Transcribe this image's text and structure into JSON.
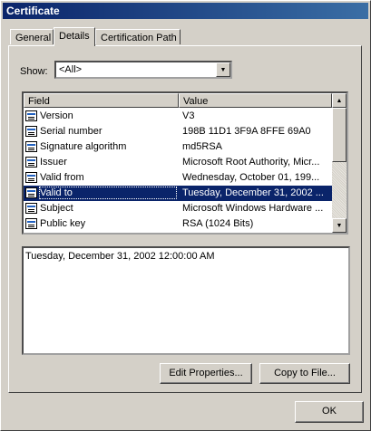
{
  "window": {
    "title": "Certificate"
  },
  "tabs": [
    "General",
    "Details",
    "Certification Path"
  ],
  "show": {
    "label": "Show:",
    "value": "<All>"
  },
  "list": {
    "columns": [
      "Field",
      "Value"
    ],
    "rows": [
      {
        "field": "Version",
        "value": "V3"
      },
      {
        "field": "Serial number",
        "value": "198B 11D1 3F9A 8FFE 69A0"
      },
      {
        "field": "Signature algorithm",
        "value": "md5RSA"
      },
      {
        "field": "Issuer",
        "value": "Microsoft Root Authority, Micr..."
      },
      {
        "field": "Valid from",
        "value": "Wednesday, October 01, 199..."
      },
      {
        "field": "Valid to",
        "value": "Tuesday, December 31, 2002 ..."
      },
      {
        "field": "Subject",
        "value": "Microsoft Windows Hardware ..."
      },
      {
        "field": "Public key",
        "value": "RSA (1024 Bits)"
      }
    ],
    "selected_field": "Valid to"
  },
  "detail_text": "Tuesday, December 31, 2002 12:00:00 AM",
  "buttons": {
    "edit": "Edit Properties...",
    "copy": "Copy to File...",
    "ok": "OK"
  },
  "colors": {
    "title_bar": "#0a246a",
    "selection": "#0a246a",
    "face": "#d4d0c8"
  }
}
